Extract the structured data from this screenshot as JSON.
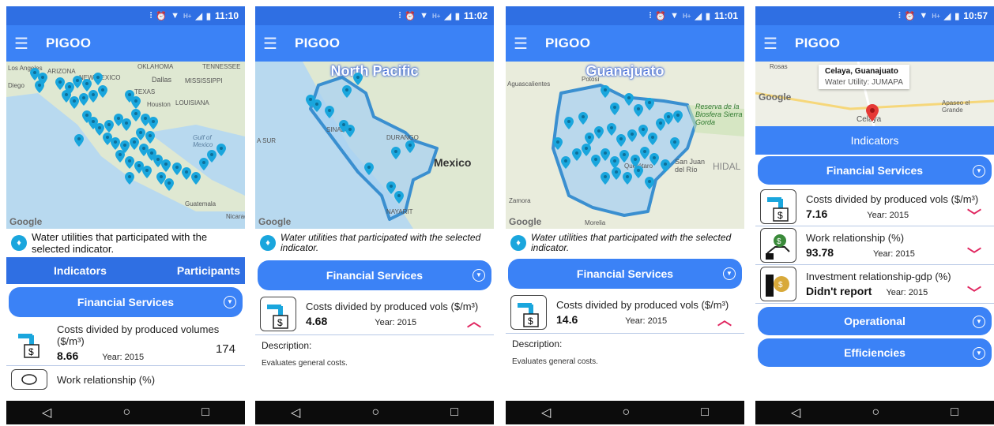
{
  "colors": {
    "statusbar": "#2f6fe3",
    "appbar": "#3b82f6",
    "accent": "#e0245e",
    "pin": "#1aa6dd"
  },
  "screens": [
    {
      "time": "11:10",
      "app_title": "PIGOO",
      "map_labels": [
        "Los Angeles",
        "ARIZONA",
        "NEW MEXICO",
        "OKLAHOMA",
        "TENNESSEE",
        "Dallas",
        "MISSISSIPPI",
        "TEXAS",
        "Houston",
        "LOUISIANA",
        "Gulf of Mexico",
        "Guatemala",
        "Nicaragua",
        "Diego"
      ],
      "google": "Google",
      "info": "Water utilities that participated with the selected indicator.",
      "tabs": [
        "Indicators",
        "Participants"
      ],
      "section": "Financial Services",
      "rows": [
        {
          "name": "Costs divided by produced volumes ($/m³)",
          "value": "8.66",
          "year": "Year: 2015",
          "count": "174"
        },
        {
          "name": "Work relationship (%)"
        }
      ]
    },
    {
      "time": "11:02",
      "app_title": "PIGOO",
      "map_title": "North Pacific",
      "map_labels": [
        "A SUR",
        "SINALOA",
        "DURANGO",
        "Mexico",
        "NAYARIT"
      ],
      "google": "Google",
      "info": "Water utilities that participated with the selected indicator.",
      "section": "Financial Services",
      "rows": [
        {
          "name": "Costs divided by produced vols ($/m³)",
          "value": "4.68",
          "year": "Year: 2015"
        }
      ],
      "desc_label": "Description:",
      "desc_text": "Evaluates general costs."
    },
    {
      "time": "11:01",
      "app_title": "PIGOO",
      "map_title": "Guanajuato",
      "map_labels": [
        "Aguascalientes",
        "Potosí",
        "Reserva de la Biosfera Sierra Gorda",
        "San Juan del Río",
        "HIDAL",
        "Zamora",
        "Morelia",
        "Querétaro"
      ],
      "google": "Google",
      "info": "Water utilities that participated with the selected indicator.",
      "section": "Financial Services",
      "rows": [
        {
          "name": "Costs divided by produced vols ($/m³)",
          "value": "14.6",
          "year": "Year: 2015"
        }
      ],
      "desc_label": "Description:",
      "desc_text": "Evaluates general costs."
    },
    {
      "time": "10:57",
      "app_title": "PIGOO",
      "callout_title": "Celaya, Guanajuato",
      "callout_sub": "Water Utility: JUMAPA",
      "map_labels": [
        "Rosas",
        "Apaseo el Grande",
        "Celaya"
      ],
      "google": "Google",
      "indicators_header": "Indicators",
      "section": "Financial Services",
      "rows": [
        {
          "name": "Costs divided by produced vols ($/m³)",
          "value": "7.16",
          "year": "Year: 2015"
        },
        {
          "name": "Work relationship (%)",
          "value": "93.78",
          "year": "Year: 2015"
        },
        {
          "name": "Investment relationship-gdp (%)",
          "value": "Didn't report",
          "year": "Year: 2015"
        }
      ],
      "sections_more": [
        "Operational",
        "Efficiencies"
      ]
    }
  ],
  "nav": {
    "back": "◁",
    "home": "○",
    "recent": "□"
  }
}
